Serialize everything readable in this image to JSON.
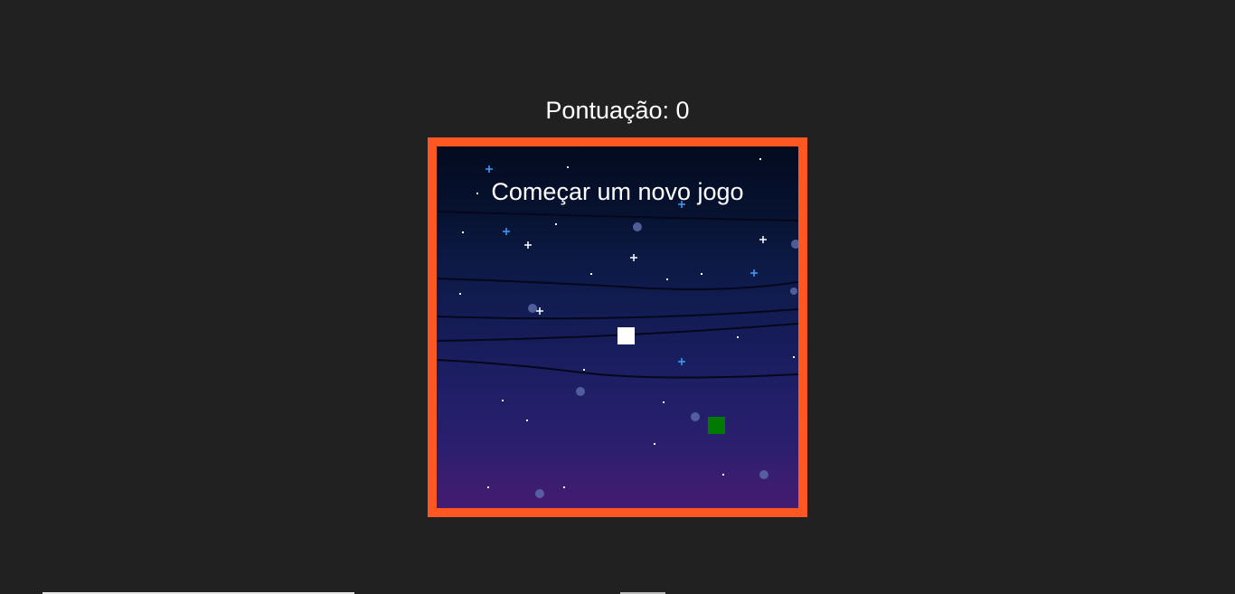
{
  "hud": {
    "score_label": "Pontuação: 0",
    "score_value": 0
  },
  "game": {
    "new_game_label": "Começar um novo jogo",
    "border_color": "#ff5722",
    "player_color": "#ffffff",
    "target_color": "#007a00"
  }
}
